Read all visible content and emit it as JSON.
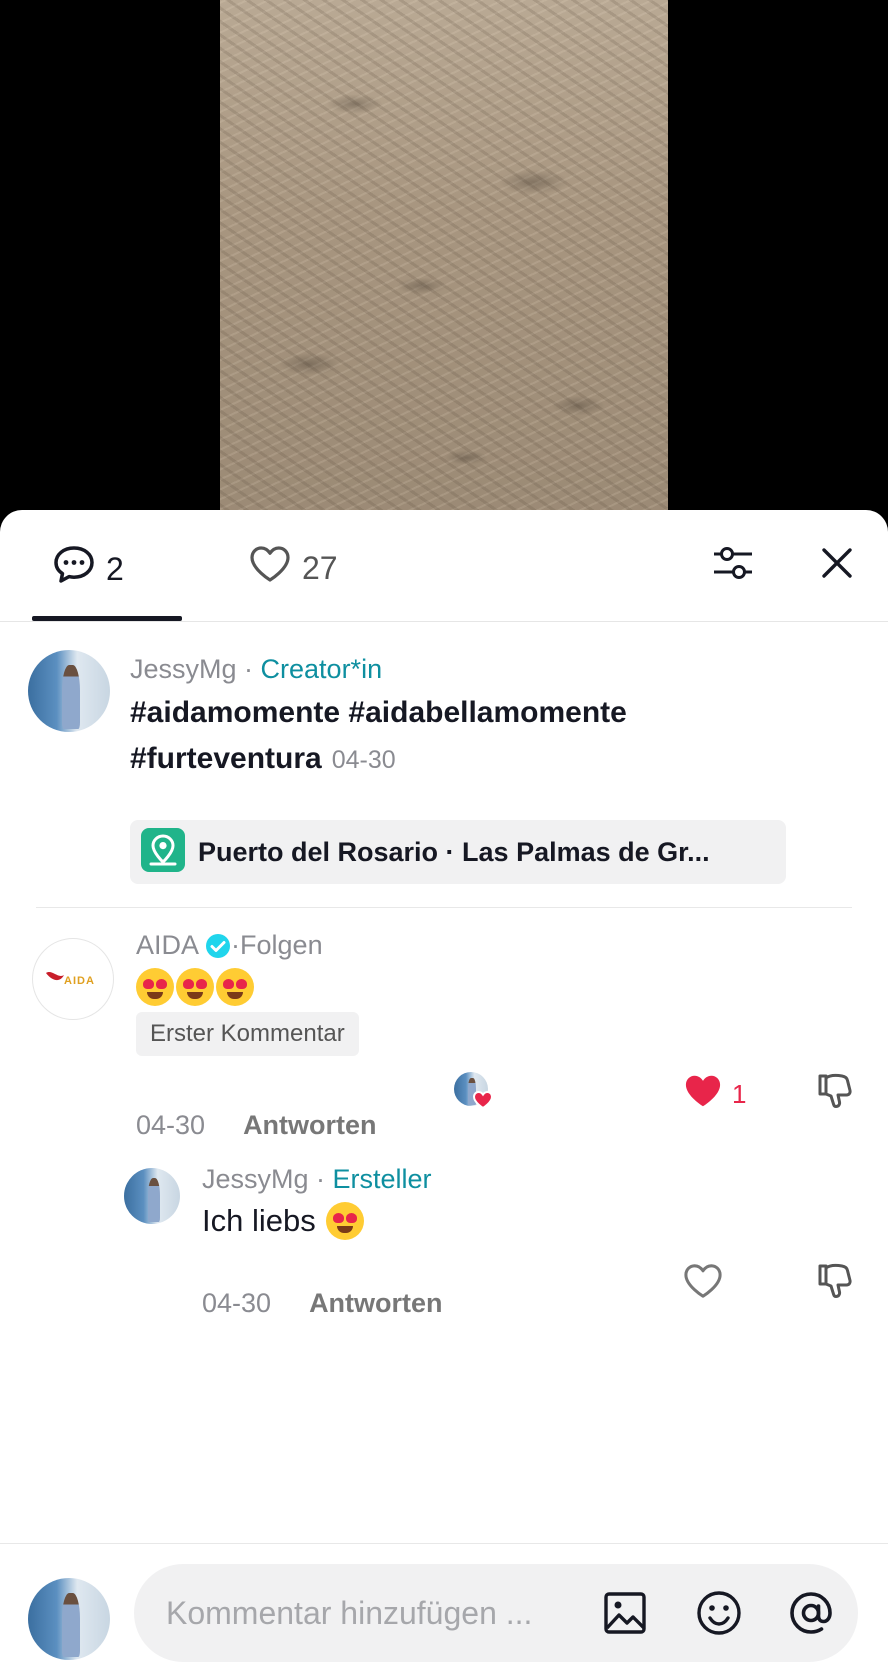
{
  "video": {
    "icon": "video-frame"
  },
  "tabs": {
    "comments_count": "2",
    "likes_count": "27"
  },
  "caption": {
    "author": "JessyMg",
    "separator": " · ",
    "role": "Creator*in",
    "text": "#aidamomente #aidabellamomente #furteventura",
    "date": "04-30"
  },
  "location": {
    "label": "Puerto del Rosario · Las Palmas de Gr..."
  },
  "comments": [
    {
      "author": "AIDA",
      "separator": " · ",
      "follow_label": "Folgen",
      "avatar_text": "AIDA",
      "badge": "Erster Kommentar",
      "date": "04-30",
      "reply_label": "Antworten",
      "like_count": "1"
    },
    {
      "author": "JessyMg",
      "separator": " · ",
      "role": "Ersteller",
      "text": "Ich liebs",
      "date": "04-30",
      "reply_label": "Antworten"
    }
  ],
  "input": {
    "placeholder": "Kommentar hinzufügen ..."
  },
  "colors": {
    "accent_teal": "#0e8fa0",
    "like_red": "#e8254a",
    "verified_blue": "#20d5ec"
  }
}
